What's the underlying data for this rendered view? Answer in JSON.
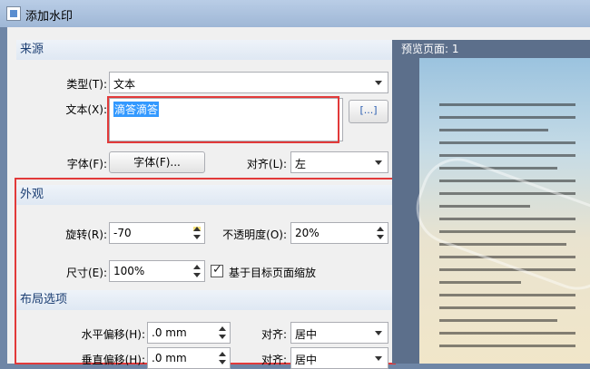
{
  "window": {
    "title": "添加水印"
  },
  "source": {
    "heading": "来源",
    "type_label": "类型(T):",
    "type_value": "文本",
    "text_label": "文本(X):",
    "text_value": "滴答滴答",
    "insert_button": "[...]",
    "font_label": "字体(F):",
    "font_button": "字体(F)...",
    "align_label": "对齐(L):",
    "align_value": "左"
  },
  "appearance": {
    "heading": "外观",
    "rotate_label": "旋转(R):",
    "rotate_value": "-70",
    "opacity_label": "不透明度(O):",
    "opacity_value": "20%",
    "size_label": "尺寸(E):",
    "size_value": "100%",
    "scale_checkbox_label": "基于目标页面缩放",
    "scale_checked": true
  },
  "layout": {
    "heading": "布局选项",
    "h_offset_label": "水平偏移(H):",
    "h_offset_value": ".0 mm",
    "v_offset_label": "垂直偏移(H):",
    "v_offset_value": ".0 mm",
    "align1_label": "对齐:",
    "align1_value": "居中",
    "align2_label": "对齐:",
    "align2_value": "居中"
  },
  "preview": {
    "title": "预览页面: 1"
  }
}
